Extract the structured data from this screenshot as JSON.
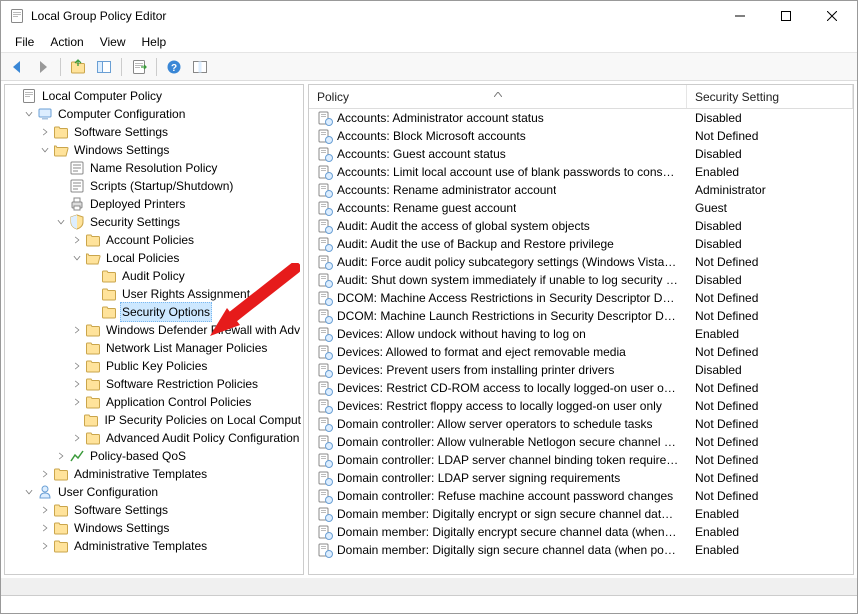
{
  "title": "Local Group Policy Editor",
  "menu": [
    "File",
    "Action",
    "View",
    "Help"
  ],
  "columns": {
    "policy": "Policy",
    "setting": "Security Setting"
  },
  "tree": {
    "root": "Local Computer Policy",
    "compConf": "Computer Configuration",
    "softSet1": "Software Settings",
    "winSet1": "Windows Settings",
    "nameRes": "Name Resolution Policy",
    "scripts": "Scripts (Startup/Shutdown)",
    "depPrinters": "Deployed Printers",
    "secSettings": "Security Settings",
    "acctPol": "Account Policies",
    "localPol": "Local Policies",
    "auditPol": "Audit Policy",
    "userRights": "User Rights Assignment",
    "secOptions": "Security Options",
    "wfAdv": "Windows Defender Firewall with Adv",
    "netList": "Network List Manager Policies",
    "pubKey": "Public Key Policies",
    "softRestrict": "Software Restriction Policies",
    "appCtrl": "Application Control Policies",
    "ipSec": "IP Security Policies on Local Comput",
    "advAudit": "Advanced Audit Policy Configuration",
    "qos": "Policy-based QoS",
    "adminT1": "Administrative Templates",
    "userConf": "User Configuration",
    "softSet2": "Software Settings",
    "winSet2": "Windows Settings",
    "adminT2": "Administrative Templates"
  },
  "rows": [
    {
      "p": "Accounts: Administrator account status",
      "s": "Disabled"
    },
    {
      "p": "Accounts: Block Microsoft accounts",
      "s": "Not Defined"
    },
    {
      "p": "Accounts: Guest account status",
      "s": "Disabled"
    },
    {
      "p": "Accounts: Limit local account use of blank passwords to console l...",
      "s": "Enabled"
    },
    {
      "p": "Accounts: Rename administrator account",
      "s": "Administrator"
    },
    {
      "p": "Accounts: Rename guest account",
      "s": "Guest"
    },
    {
      "p": "Audit: Audit the access of global system objects",
      "s": "Disabled"
    },
    {
      "p": "Audit: Audit the use of Backup and Restore privilege",
      "s": "Disabled"
    },
    {
      "p": "Audit: Force audit policy subcategory settings (Windows Vista or l...",
      "s": "Not Defined"
    },
    {
      "p": "Audit: Shut down system immediately if unable to log security au...",
      "s": "Disabled"
    },
    {
      "p": "DCOM: Machine Access Restrictions in Security Descriptor Definiti...",
      "s": "Not Defined"
    },
    {
      "p": "DCOM: Machine Launch Restrictions in Security Descriptor Definit...",
      "s": "Not Defined"
    },
    {
      "p": "Devices: Allow undock without having to log on",
      "s": "Enabled"
    },
    {
      "p": "Devices: Allowed to format and eject removable media",
      "s": "Not Defined"
    },
    {
      "p": "Devices: Prevent users from installing printer drivers",
      "s": "Disabled"
    },
    {
      "p": "Devices: Restrict CD-ROM access to locally logged-on user only",
      "s": "Not Defined"
    },
    {
      "p": "Devices: Restrict floppy access to locally logged-on user only",
      "s": "Not Defined"
    },
    {
      "p": "Domain controller: Allow server operators to schedule tasks",
      "s": "Not Defined"
    },
    {
      "p": "Domain controller: Allow vulnerable Netlogon secure channel con...",
      "s": "Not Defined"
    },
    {
      "p": "Domain controller: LDAP server channel binding token requireme...",
      "s": "Not Defined"
    },
    {
      "p": "Domain controller: LDAP server signing requirements",
      "s": "Not Defined"
    },
    {
      "p": "Domain controller: Refuse machine account password changes",
      "s": "Not Defined"
    },
    {
      "p": "Domain member: Digitally encrypt or sign secure channel data (al...",
      "s": "Enabled"
    },
    {
      "p": "Domain member: Digitally encrypt secure channel data (when pos...",
      "s": "Enabled"
    },
    {
      "p": "Domain member: Digitally sign secure channel data (when possible)",
      "s": "Enabled"
    }
  ]
}
